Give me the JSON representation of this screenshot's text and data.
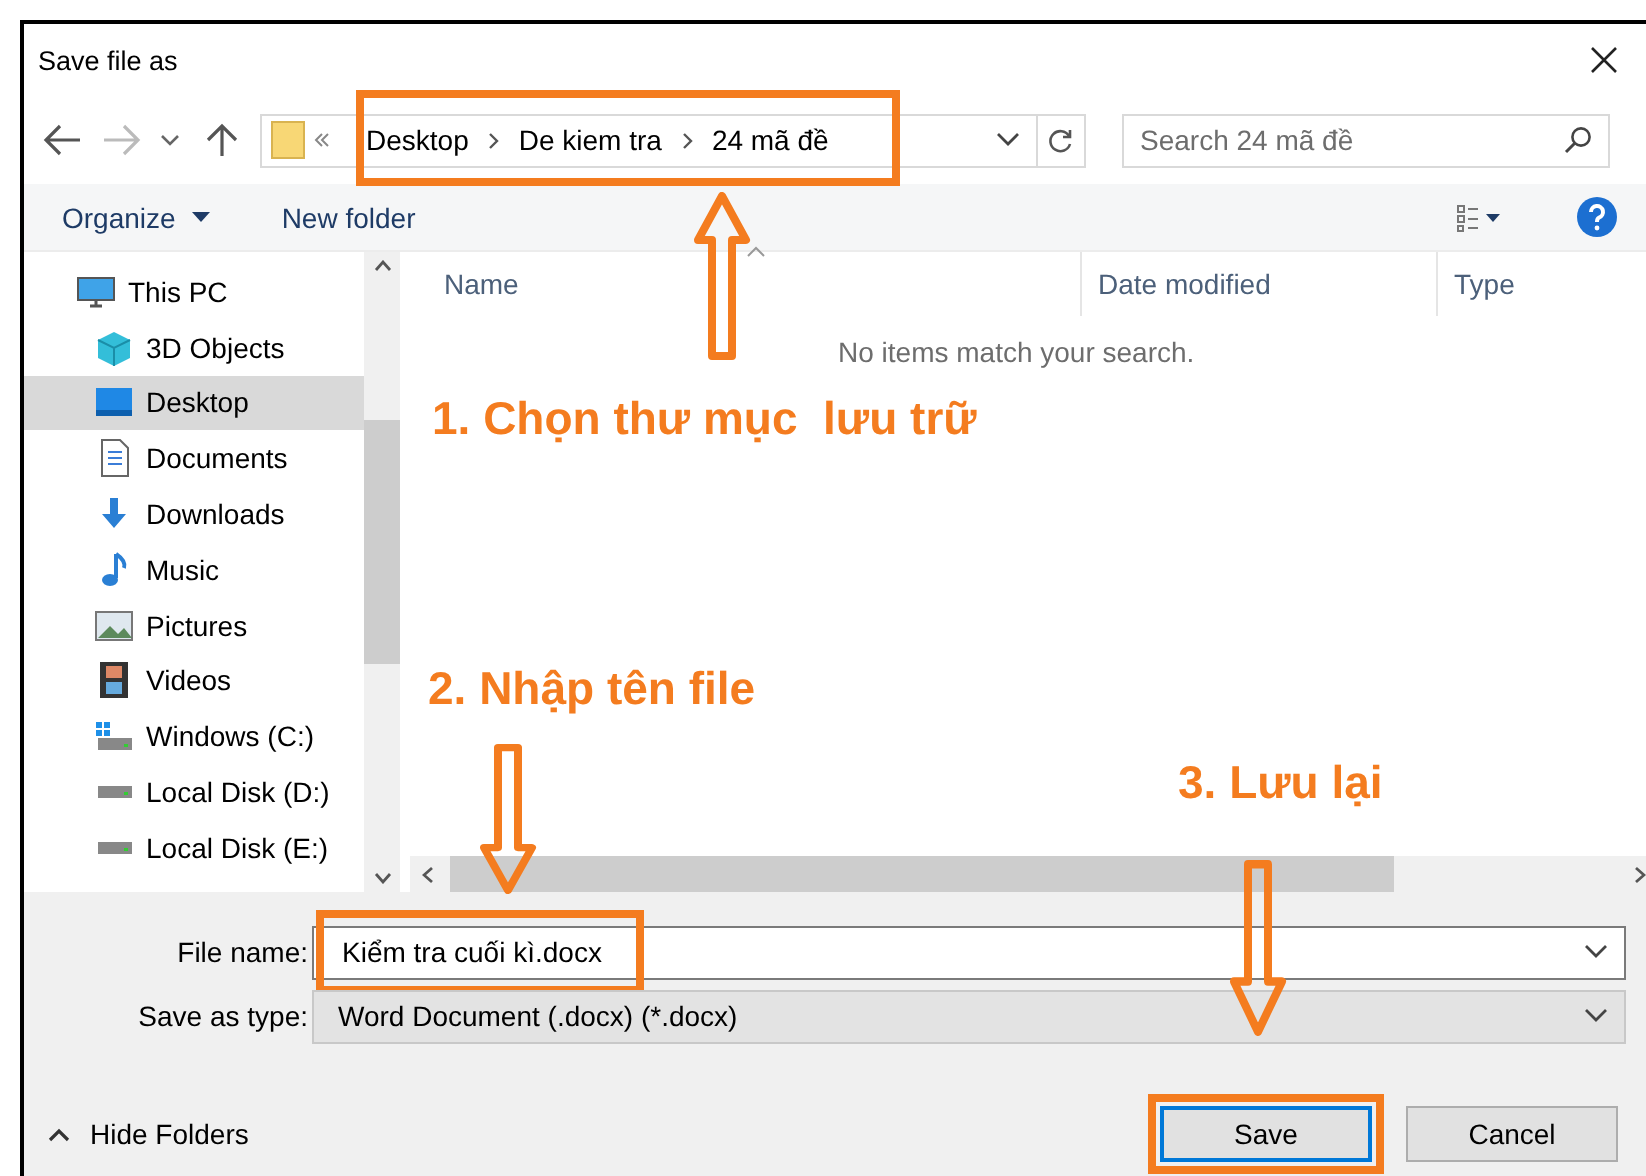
{
  "window": {
    "title": "Save file as"
  },
  "address": {
    "crumbs": [
      "Desktop",
      "De kiem tra",
      "24 mã đề"
    ],
    "highlighted": true
  },
  "search": {
    "placeholder": "Search 24 mã đề"
  },
  "toolbar": {
    "buttons": [
      {
        "label": "Organize",
        "kind": "menu"
      },
      {
        "label": "New folder",
        "kind": "plain"
      }
    ]
  },
  "sidebar": {
    "items": [
      {
        "label": "This PC",
        "kind": "pc",
        "selected": false,
        "children": [
          {
            "label": "3D Objects",
            "kind": "cube",
            "selected": false
          },
          {
            "label": "Desktop",
            "kind": "desktop",
            "selected": true
          },
          {
            "label": "Documents",
            "kind": "document",
            "selected": false
          },
          {
            "label": "Downloads",
            "kind": "download",
            "selected": false
          },
          {
            "label": "Music",
            "kind": "music",
            "selected": false
          },
          {
            "label": "Pictures",
            "kind": "pictures",
            "selected": false
          },
          {
            "label": "Videos",
            "kind": "video",
            "selected": false
          },
          {
            "label": "Windows (C:)",
            "kind": "system-drive",
            "selected": false
          },
          {
            "label": "Local Disk (D:)",
            "kind": "drive",
            "selected": false
          },
          {
            "label": "Local Disk (E:)",
            "kind": "drive",
            "selected": false
          }
        ]
      }
    ]
  },
  "file_list": {
    "columns": [
      "Name",
      "Date modified",
      "Type"
    ],
    "empty_message": "No items match your search."
  },
  "form": {
    "file_name_label": "File name:",
    "file_name": "Kiểm tra cuối kì.docx",
    "file_name_highlighted": true,
    "type_label": "Save as type:",
    "type": "Word Document (.docx) (*.docx)"
  },
  "hide_folders": "Hide Folders",
  "buttons": [
    {
      "label": "Save",
      "default": true,
      "highlighted": true
    },
    {
      "label": "Cancel",
      "default": false,
      "highlighted": false
    }
  ],
  "annotations": [
    {
      "text": "1. Chọn thư mục  lưu trữ",
      "kind": "up"
    },
    {
      "text": "2. Nhập tên file",
      "kind": "down"
    },
    {
      "text": "3. Lưu lại",
      "kind": "down"
    }
  ]
}
